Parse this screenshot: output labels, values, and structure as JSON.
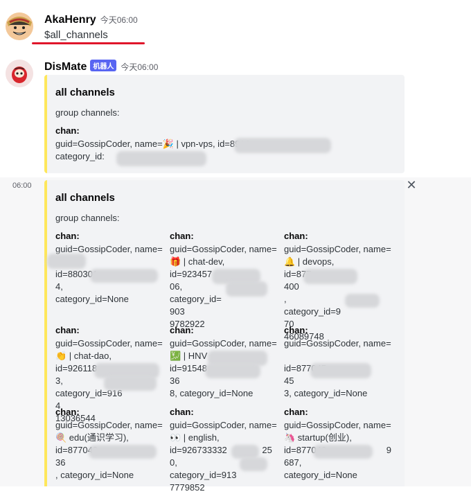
{
  "message1": {
    "author": "AkaHenry",
    "timestamp": "今天06:00",
    "content": "$all_channels",
    "underline_color": "#e0162b"
  },
  "message2": {
    "author": "DisMate",
    "bot_badge": "机器人",
    "timestamp": "今天06:00",
    "embed": {
      "title": "all channels",
      "description": "group channels:",
      "field": {
        "name": "chan:",
        "value": "guid=GossipCoder, name=🎉 | vpn-vps, id=8913\ncategory_id:"
      }
    }
  },
  "message3": {
    "side_timestamp": "06:00",
    "close_label": "✕",
    "embed": {
      "title": "all channels",
      "description": "group channels:",
      "fields": [
        {
          "name": "chan:",
          "value": "guid=GossipCoder, name=\n\nid=880301                              4,\ncategory_id=None"
        },
        {
          "name": "chan:",
          "value": "guid=GossipCoder, name=\n🎁 | chat-dev,\nid=923457                          06,\ncategory_id=                      903\n9782922"
        },
        {
          "name": "chan:",
          "value": "guid=GossipCoder, name=\n🔔 | devops,\nid=877                                400\n,\ncategory_id=9                    70\n46089748"
        },
        {
          "name": "chan:",
          "value": "guid=GossipCoder, name=\n👏 | chat-dao,\nid=926118                            3,\ncategory_id=916                      4\n13036544"
        },
        {
          "name": "chan:",
          "value": "guid=GossipCoder, name=\n💹 | HNV\nid=91548                              36\n8, category_id=None"
        },
        {
          "name": "chan:",
          "value": "guid=GossipCoder, name=\n\nid=877045                              45\n3, category_id=None"
        },
        {
          "name": "chan:",
          "value": "guid=GossipCoder, name=\n🍭 edu(通识学习),\nid=877043                            36\n, category_id=None"
        },
        {
          "name": "chan:",
          "value": "guid=GossipCoder, name=\n👀 | english,\nid=926733332              250,\ncategory_id=913\n7779852"
        },
        {
          "name": "chan:",
          "value": "guid=GossipCoder, name=\n🦄 startup(创业),\nid=877046                        9687,\ncategory_id=None"
        }
      ]
    }
  },
  "colors": {
    "embed_border": "#fee75c",
    "embed_bg": "#f2f3f5",
    "bot_badge_bg": "#5865f2"
  },
  "icons": {
    "avatar1": "luffy-avatar",
    "avatar2": "daruma-avatar",
    "close": "close-icon"
  }
}
